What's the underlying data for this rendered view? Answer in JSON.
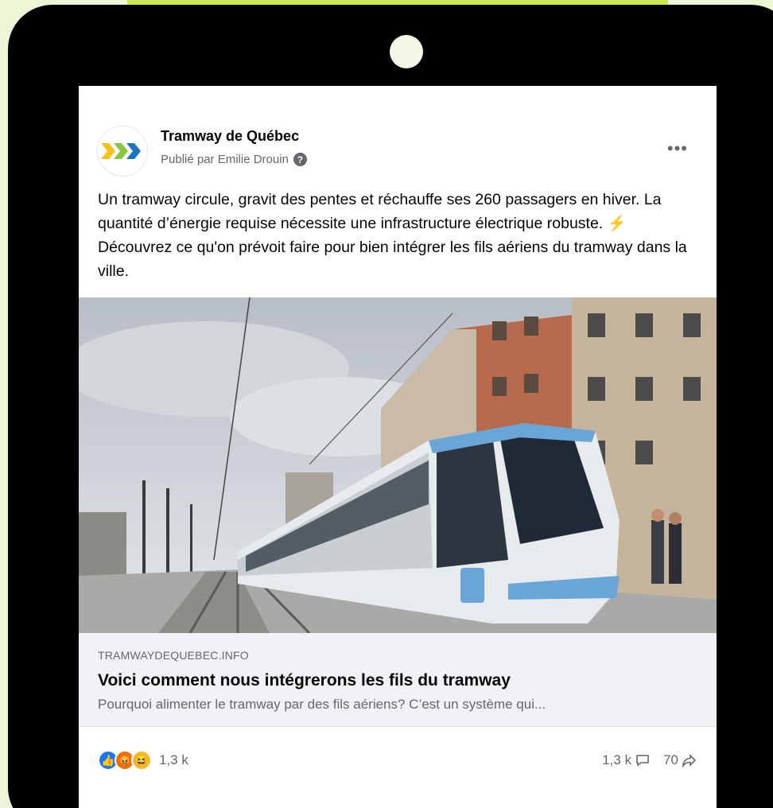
{
  "post": {
    "page_name": "Tramway de Québec",
    "byline": "Publié par Emilie Drouin",
    "more_icon": "more-horizontal-icon",
    "text_before": "Un tramway circule, gravit des pentes et réchauffe ses 260 passagers en hiver. La quantité d’énergie requise nécessite une infrastructure électrique robuste.",
    "emoji": "⚡",
    "text_after": " Découvrez ce qu'on prévoit faire pour bien intégrer les fils aériens du tramway dans la ville."
  },
  "link": {
    "domain": "TRAMWAYDEQUEBEC.INFO",
    "title": "Voici comment nous intégrerons les fils du tramway",
    "description": "Pourquoi alimenter le tramway par des fils aériens? C’est un système qui..."
  },
  "stats": {
    "reactions": [
      "like",
      "angry",
      "haha"
    ],
    "reaction_count": "1,3 k",
    "comment_count": "1,3 k",
    "share_count": "70"
  },
  "colors": {
    "background": "#ecf5d6",
    "accent_green": "#c9ea56",
    "like_blue": "#1877f2",
    "logo_yellow": "#f2c21a",
    "logo_green": "#8bc53f",
    "logo_blue": "#1c75bc"
  }
}
